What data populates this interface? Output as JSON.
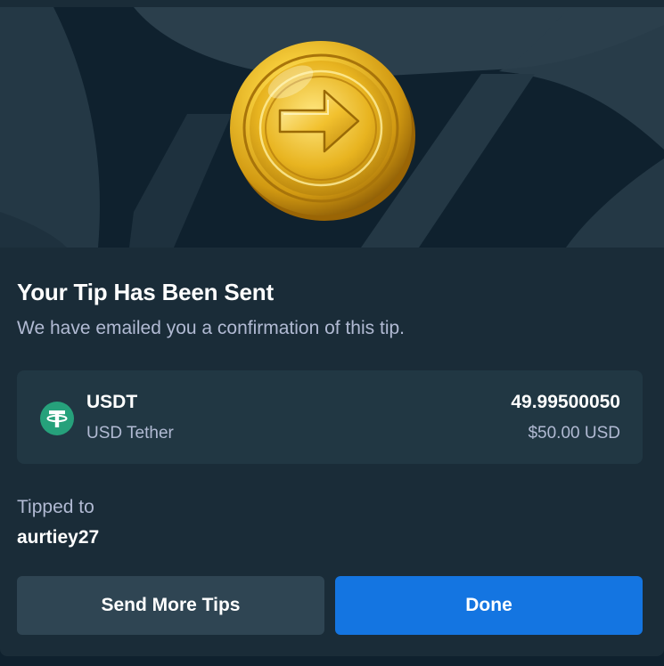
{
  "modal": {
    "title": "Your Tip Has Been Sent",
    "subtitle": "We have emailed you a confirmation of this tip."
  },
  "hero": {
    "icon": "gold-coin-arrow-icon"
  },
  "currency_card": {
    "icon": "tether-icon",
    "code": "USDT",
    "name": "USD Tether",
    "amount": "49.99500050",
    "usd_value": "$50.00 USD"
  },
  "recipient": {
    "label": "Tipped to",
    "username": "aurtiey27"
  },
  "buttons": {
    "send_more": "Send More Tips",
    "done": "Done"
  },
  "colors": {
    "background": "#0f212e",
    "panel": "#1a2c38",
    "card": "#213743",
    "secondary_button": "#2f4553",
    "primary_button": "#1475e1",
    "muted_text": "#b1bad3",
    "tether_green": "#26a17b",
    "coin_gold": "#e8b420"
  }
}
